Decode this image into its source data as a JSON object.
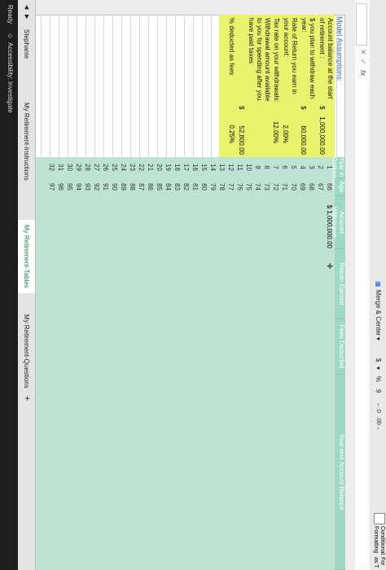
{
  "ribbon": {
    "merge_label": "Merge & Center",
    "currency_symbol": "$",
    "percent_symbol": "%",
    "comma_symbol": "9",
    "cond_format_label": "Conditional Formatting",
    "format_label": "For as T"
  },
  "formula_bar": {
    "fx": "fx"
  },
  "model": {
    "header": "Model Assumptions:",
    "items": [
      {
        "label": "Account balance at the start of retirement :",
        "cur": "$",
        "value": "1,000,000.00"
      },
      {
        "label": "$ you plan to withdraw each year:",
        "cur": "$",
        "value": "60,000.00"
      },
      {
        "label": "Rate of Return you earn in your account:",
        "cur": "",
        "value": "2.00%"
      },
      {
        "label": "Tax rate on your withdrawals:",
        "cur": "",
        "value": "12.00%"
      },
      {
        "label": "Withdrawal amount available to you for spending after you have paid taxes",
        "cur": "$",
        "value": "52,800.00"
      },
      {
        "label": "% deducted as fees",
        "cur": "",
        "value": "0.25%"
      }
    ]
  },
  "table": {
    "headers": {
      "year": "Year in Retirement",
      "age": "Age",
      "withdrawn": "Amount Withdrawn",
      "return": "Return Earned",
      "fees": "Fees Deducted",
      "balance": "Year-end Account Balance"
    },
    "first_withdrawn": "$ 1,000,000.00",
    "years": [
      "1",
      "2",
      "3",
      "4",
      "5",
      "6",
      "7",
      "8",
      "9",
      "10",
      "11",
      "12",
      "13",
      "14",
      "15",
      "16",
      "17",
      "18",
      "19",
      "20",
      "21",
      "22",
      "23",
      "24",
      "25",
      "26",
      "27",
      "28",
      "29",
      "30",
      "31",
      "32"
    ],
    "ages": [
      "66",
      "67",
      "68",
      "69",
      "70",
      "71",
      "72",
      "73",
      "74",
      "75",
      "76",
      "77",
      "78",
      "79",
      "80",
      "81",
      "82",
      "83",
      "84",
      "85",
      "86",
      "87",
      "88",
      "89",
      "90",
      "91",
      "92",
      "93",
      "94",
      "95",
      "96",
      "97"
    ]
  },
  "tabs": [
    "Stephanie",
    "My Retirement-Instructions",
    "My Retirement-Tables",
    "My Retirement-Questions"
  ],
  "tab_add": "+",
  "status": {
    "ready": "Ready",
    "accessibility": "Accessibility: Investigate"
  },
  "colors": {
    "assumptions": "#e9f36e",
    "table_header": "#9ed8c5",
    "table_body": "#bfe3d3"
  }
}
